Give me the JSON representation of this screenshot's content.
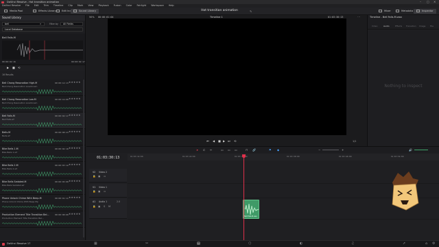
{
  "window": {
    "title": "DaVinci Resolve - Hot transition animation"
  },
  "menu": [
    "DaVinci Resolve",
    "File",
    "Edit",
    "Trim",
    "Timeline",
    "Clip",
    "Mark",
    "View",
    "Playback",
    "Fusion",
    "Color",
    "Fairlight",
    "Workspace",
    "Help"
  ],
  "toolbar": {
    "media_pool": "Media Pool",
    "effects_library": "Effects Library",
    "edit_index": "Edit Index",
    "sound_library": "Sound Library",
    "project_title": "Hot transition animation",
    "mixer": "Mixer",
    "metadata": "Metadata",
    "inspector": "Inspector"
  },
  "sound_library": {
    "title": "Sound Library",
    "search_value": "bell",
    "filter_label": "Filter by",
    "filter_value": "All Fields",
    "database": "Local Database",
    "preview": {
      "name": "Bell Falls.M",
      "time_start": "00:00:02:16",
      "time_end": "00:00:02:17"
    },
    "results_count": "16 Results",
    "items": [
      {
        "name": "Bell Chong Resonation High.M",
        "sub": "Bell Chong Resonation Low.Known",
        "time": "00:00:14:13",
        "stars": "★★★★★"
      },
      {
        "name": "Bell Chong Resonation Low.M",
        "sub": "Bell Chong Resonation Low.Known",
        "time": "00:00:16:00",
        "stars": "★★★★★"
      },
      {
        "name": "Bell Falls.M",
        "sub": "Bell Falls.wf",
        "time": "00:00:02:17",
        "stars": "★★★★★"
      },
      {
        "name": "Bells.M",
        "sub": "Bells.wf",
        "time": "00:00:08:23",
        "stars": "★★★★★"
      },
      {
        "name": "Bike Bells 1.M",
        "sub": "Bike Bells 1.wf",
        "time": "00:00:04:10",
        "stars": "★★★★★"
      },
      {
        "name": "Bike Bells 2.M",
        "sub": "Bike Bells 2.wf",
        "time": "00:00:03:12",
        "stars": "★★★★★"
      },
      {
        "name": "Bike Bells Sedated.M",
        "sub": "Bike Bells Sedated.wf",
        "time": "00:00:05:00",
        "stars": "★★★★★"
      },
      {
        "name": "Phone Unlock Chime With Beep.M",
        "sub": "Phone Unlock Chime With Beep.Mp",
        "time": "00:00:01:11",
        "stars": "★★★★★"
      },
      {
        "name": "Production Element Title Transition Bel...",
        "sub": "Production Element Title Transition Bel...",
        "time": "00:00:08:00",
        "stars": "★★★★★"
      },
      {
        "name": "Production Element Title Transition Bel...",
        "sub": "Production Element Title Transition Bel...",
        "time": "00:00:09:00",
        "stars": "★★★★★"
      }
    ]
  },
  "viewer": {
    "zoom": "50%",
    "timecode": "00:00:01:04",
    "timeline_name": "Timeline 1",
    "right_timecode": "01:03:30:13",
    "scale": "1/1"
  },
  "inspector": {
    "title": "Timeline - Bell Falls.M.wav",
    "tabs": [
      "Video",
      "Audio",
      "Effects",
      "Transition",
      "Image",
      "File"
    ],
    "empty": "Nothing to inspect"
  },
  "timeline": {
    "timecode": "01:03:30:13",
    "ruler": [
      "01:03:14:00",
      "01:03:22:00",
      "01:03:30:00",
      "01:03:38:00",
      "01:03:46:00",
      "01:03:54:00"
    ],
    "tracks": [
      {
        "id": "V2",
        "name": "Video 2"
      },
      {
        "id": "V1",
        "name": "Video 1"
      },
      {
        "id": "A1",
        "name": "Audio 1",
        "level": "2.0"
      }
    ],
    "clip_label": "Bell Falls.M.wav"
  },
  "statusbar": {
    "app": "DaVinci Resolve 17"
  },
  "colors": {
    "accent": "#d83b4b",
    "clip": "#3f9a67",
    "playhead": "#e0304a"
  },
  "icons": [
    "waveform-icon",
    "play-icon",
    "stop-icon",
    "loop-icon",
    "search-icon",
    "star-icon",
    "media-page-icon",
    "cut-page-icon",
    "edit-page-icon",
    "fusion-page-icon",
    "color-page-icon",
    "fairlight-page-icon",
    "deliver-page-icon",
    "home-icon",
    "settings-icon"
  ]
}
